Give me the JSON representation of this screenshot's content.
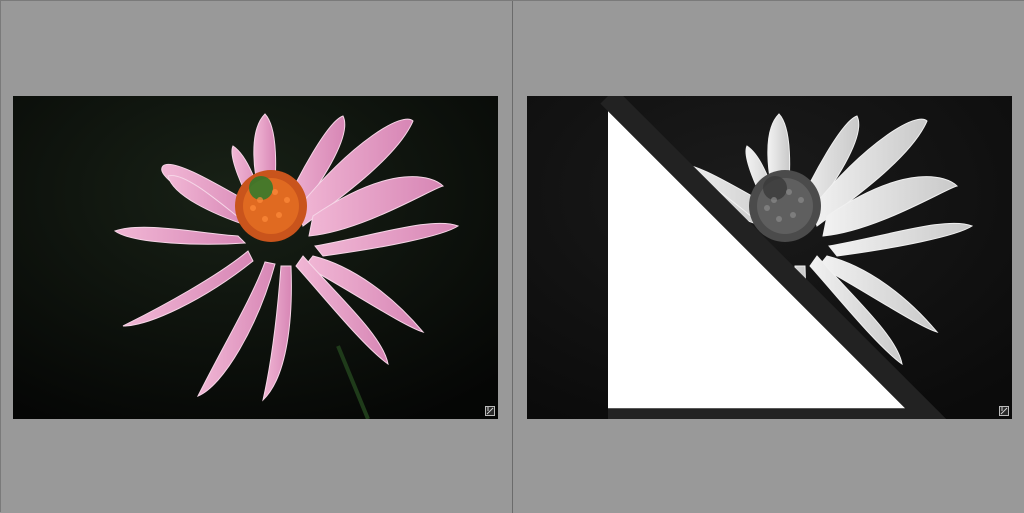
{
  "compare": {
    "left_photo": {
      "icon": "develop-adjustment-badge",
      "tone": "color"
    },
    "right_photo": {
      "icon": "develop-adjustment-badge",
      "tone": "monochrome",
      "flag": "corner-flag-icon"
    }
  },
  "colors": {
    "background": "#999999",
    "left_petal": "#e79fc6",
    "left_center": "#d8591f",
    "right_petal": "#d7d7d7",
    "right_center": "#5e5e5e"
  }
}
